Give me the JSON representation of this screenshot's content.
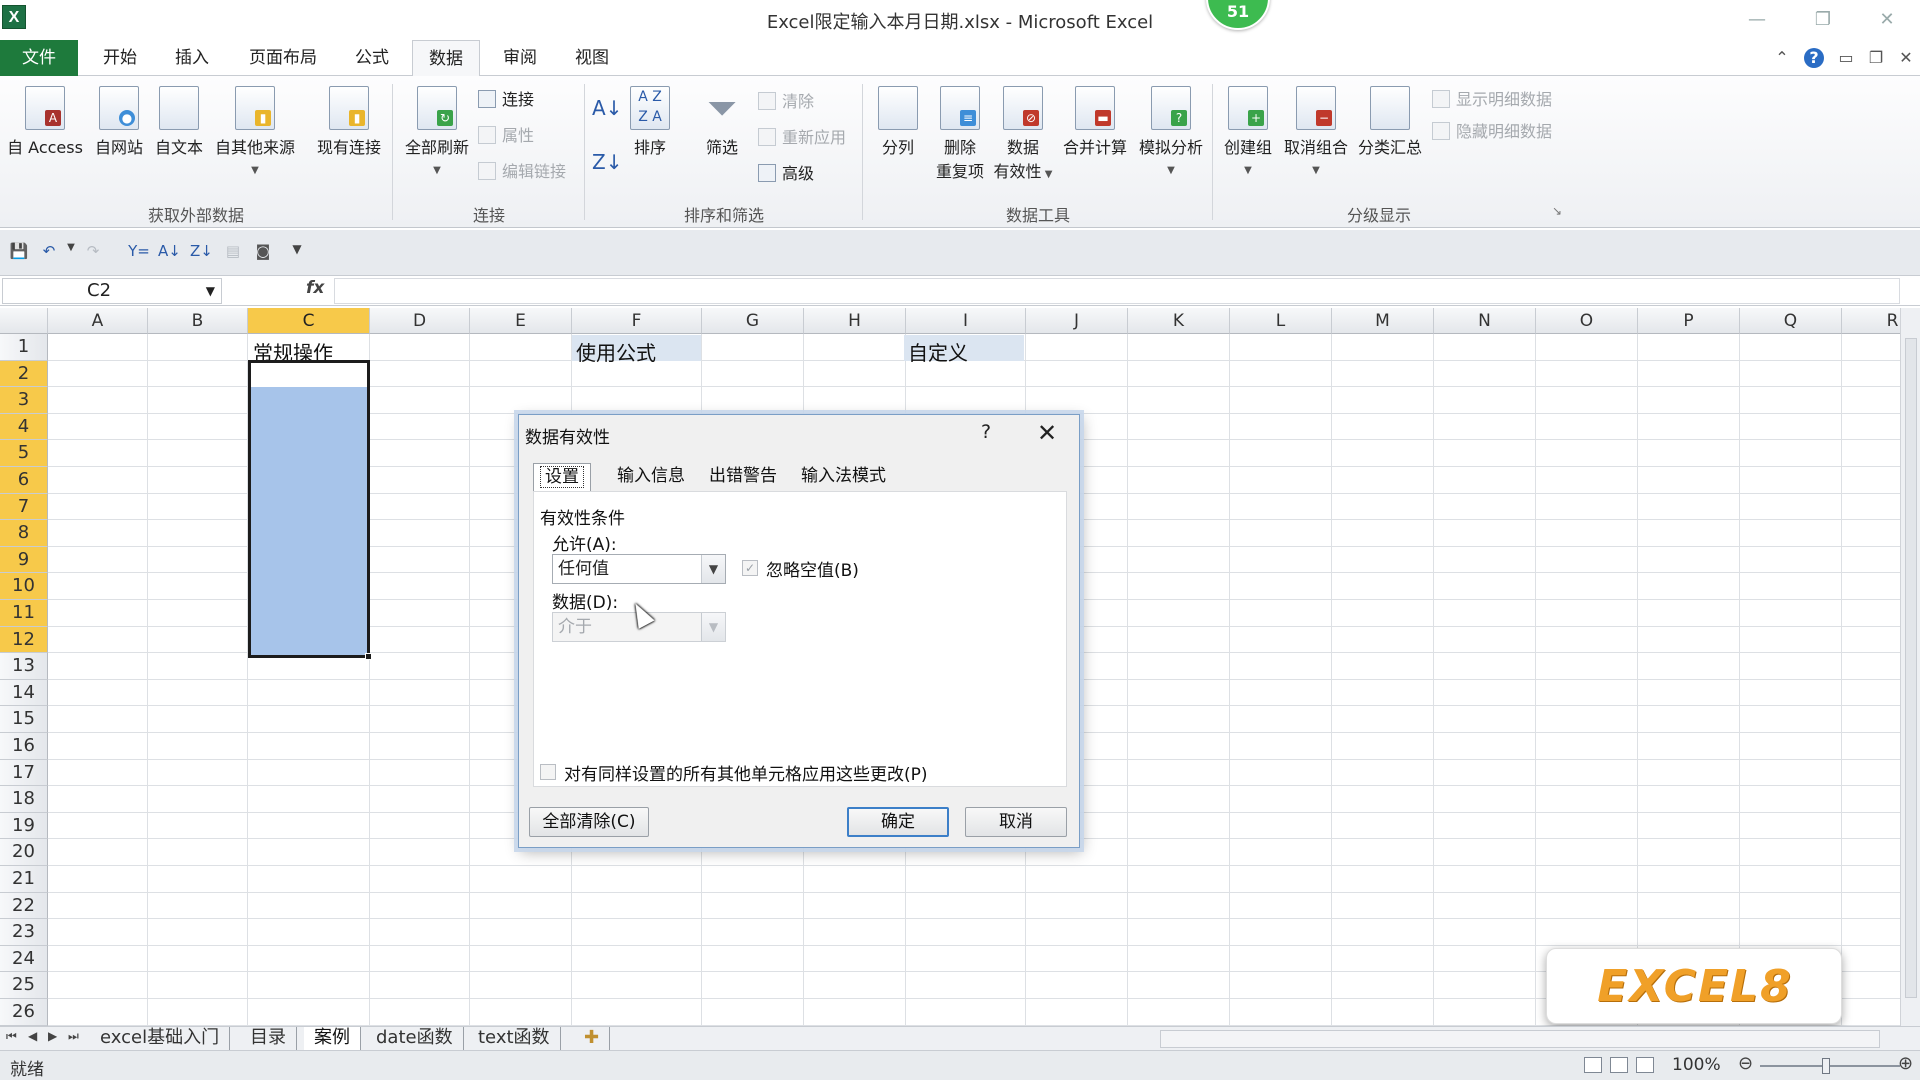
{
  "window": {
    "title": "Excel限定输入本月日期.xlsx  -  Microsoft Excel",
    "badge": "51",
    "app_icon": "X"
  },
  "ribbon_tabs": [
    {
      "label": "文件"
    },
    {
      "label": "开始"
    },
    {
      "label": "插入"
    },
    {
      "label": "页面布局"
    },
    {
      "label": "公式"
    },
    {
      "label": "数据"
    },
    {
      "label": "审阅"
    },
    {
      "label": "视图"
    }
  ],
  "ribbon": {
    "get_external": {
      "label": "获取外部数据",
      "buttons": [
        "自 Access",
        "自网站",
        "自文本",
        "自其他来源",
        "现有连接"
      ]
    },
    "connections": {
      "label": "连接",
      "refresh_all": "全部刷新",
      "items": [
        "连接",
        "属性",
        "编辑链接"
      ]
    },
    "sort_filter": {
      "label": "排序和筛选",
      "sort": "排序",
      "filter": "筛选",
      "items": [
        "清除",
        "重新应用",
        "高级"
      ]
    },
    "data_tools": {
      "label": "数据工具",
      "text_to_columns": "分列",
      "remove_dup_1": "删除",
      "remove_dup_2": "重复项",
      "validation_1": "数据",
      "validation_2": "有效性",
      "consolidate": "合并计算",
      "what_if": "模拟分析"
    },
    "outline": {
      "label": "分级显示",
      "group": "创建组",
      "ungroup": "取消组合",
      "subtotal": "分类汇总",
      "show_detail": "显示明细数据",
      "hide_detail": "隐藏明细数据"
    }
  },
  "formula_bar": {
    "name_box": "C2",
    "fx": "fx",
    "formula": ""
  },
  "grid": {
    "columns": [
      "A",
      "B",
      "C",
      "D",
      "E",
      "F",
      "G",
      "H",
      "I",
      "J",
      "K",
      "L",
      "M",
      "N",
      "O",
      "P",
      "Q",
      "R"
    ],
    "rows": [
      "1",
      "2",
      "3",
      "4",
      "5",
      "6",
      "7",
      "8",
      "9",
      "10",
      "11",
      "12",
      "13",
      "14",
      "15",
      "16",
      "17",
      "18",
      "19",
      "20",
      "21",
      "22",
      "23",
      "24",
      "25",
      "26"
    ],
    "selected_column": "C",
    "cells": {
      "C1": "常规操作",
      "F1": "使用公式",
      "I1": "自定义"
    }
  },
  "dialog": {
    "title": "数据有效性",
    "help": "?",
    "close": "✕",
    "tabs": [
      "设置",
      "输入信息",
      "出错警告",
      "输入法模式"
    ],
    "section": "有效性条件",
    "allow_label": "允许(A):",
    "allow_value": "任何值",
    "ignore_blank": "忽略空值(B)",
    "data_label": "数据(D):",
    "data_value": "介于",
    "apply_all": "对有同样设置的所有其他单元格应用这些更改(P)",
    "clear_all": "全部清除(C)",
    "ok": "确定",
    "cancel": "取消"
  },
  "sheets": [
    {
      "name": "excel基础入门"
    },
    {
      "name": "目录"
    },
    {
      "name": "案例"
    },
    {
      "name": "date函数"
    },
    {
      "name": "text函数"
    }
  ],
  "active_sheet": "案例",
  "status": {
    "ready": "就绪",
    "zoom": "100%"
  },
  "watermark": "EXCEL8"
}
